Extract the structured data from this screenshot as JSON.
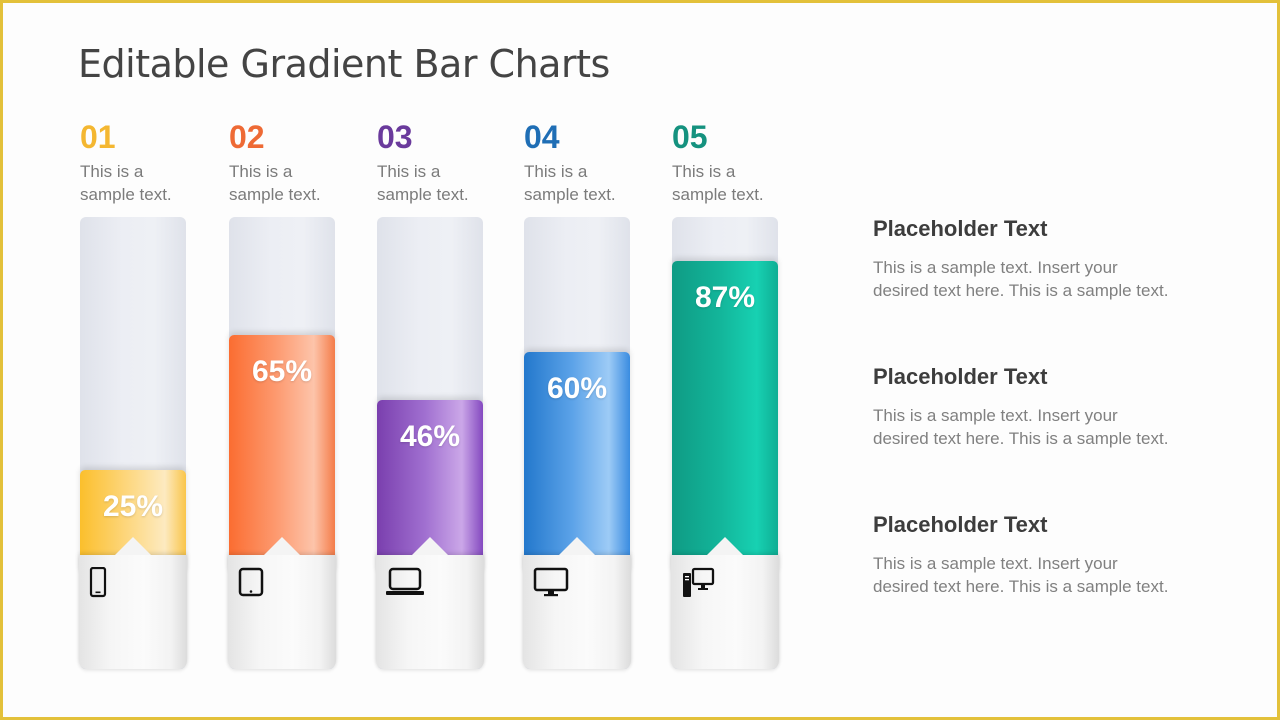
{
  "title": "Editable Gradient Bar Charts",
  "chart_data": {
    "type": "bar",
    "title": "Editable Gradient Bar Charts",
    "categories": [
      "01",
      "02",
      "03",
      "04",
      "05"
    ],
    "values": [
      25,
      65,
      46,
      60,
      87
    ],
    "value_labels": [
      "25%",
      "65%",
      "46%",
      "60%",
      "87%"
    ],
    "ylim": [
      0,
      100
    ],
    "xlabel": "",
    "ylabel": "",
    "grid": false,
    "legend": "none"
  },
  "columns": [
    {
      "number": "01",
      "line1": "This is a",
      "line2": "sample text.",
      "value": 25,
      "label": "25%",
      "icon": "smartphone-icon",
      "color": "#f4b731",
      "grad": [
        "#fbbf2c",
        "#fdd77f",
        "#fdeac0",
        "#f9c54b"
      ]
    },
    {
      "number": "02",
      "line1": "This is a",
      "line2": "sample text.",
      "value": 65,
      "label": "65%",
      "icon": "tablet-icon",
      "color": "#ee6a35",
      "grad": [
        "#fb6d31",
        "#fd9a70",
        "#fdc4aa",
        "#f47c49"
      ]
    },
    {
      "number": "03",
      "line1": "This is a",
      "line2": "sample text.",
      "value": 46,
      "label": "46%",
      "icon": "laptop-icon",
      "color": "#6a3a9c",
      "grad": [
        "#7a3fae",
        "#a06fd0",
        "#cba7e8",
        "#8449c0"
      ]
    },
    {
      "number": "04",
      "line1": "This is a",
      "line2": "sample text.",
      "value": 60,
      "label": "60%",
      "icon": "monitor-icon",
      "color": "#1f6eb5",
      "grad": [
        "#2378cc",
        "#5ba2e8",
        "#9dcbf6",
        "#3a8ce0"
      ]
    },
    {
      "number": "05",
      "line1": "This is a",
      "line2": "sample text.",
      "value": 87,
      "label": "87%",
      "icon": "desktop-computer-icon",
      "color": "#15927f",
      "grad": [
        "#0f9b84",
        "#13b59a",
        "#17d1b2",
        "#0fae94"
      ]
    }
  ],
  "side": [
    {
      "heading": "Placeholder Text",
      "body_line1": "This is a sample text. Insert your",
      "body_line2": "desired text here. This is a sample text."
    },
    {
      "heading": "Placeholder Text",
      "body_line1": "This is a sample text. Insert your",
      "body_line2": "desired text here. This is a sample text."
    },
    {
      "heading": "Placeholder Text",
      "body_line1": "This is a sample text. Insert your",
      "body_line2": "desired text here. This is a sample text."
    }
  ]
}
